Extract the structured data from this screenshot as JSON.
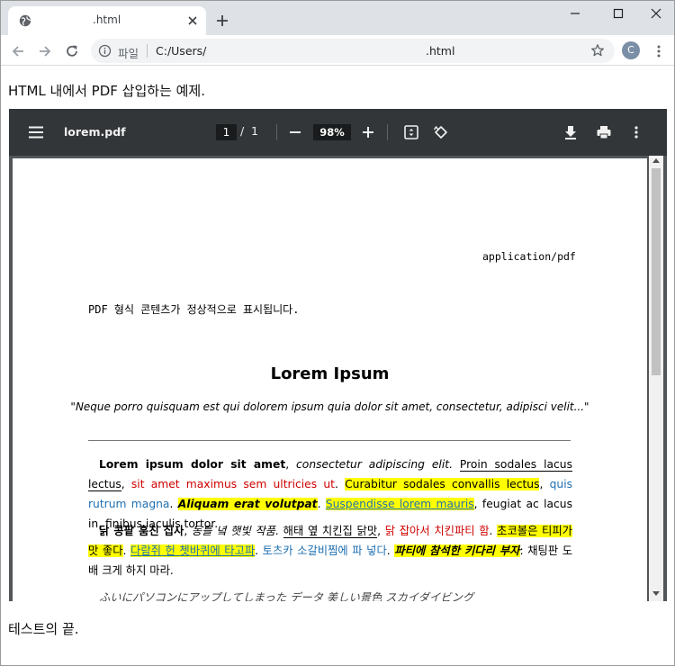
{
  "browser": {
    "tab_title": ".html",
    "url_scheme_label": "파일",
    "url_path": "C:/Users/",
    "url_file": ".html",
    "profile_initial": "C"
  },
  "page": {
    "intro": "HTML 내에서 PDF 삽입하는 예제.",
    "outro": "테스트의 끝."
  },
  "pdf_viewer": {
    "filename": "lorem.pdf",
    "current_page": "1",
    "page_separator": "/",
    "total_pages": "1",
    "zoom": "98%"
  },
  "pdf_document": {
    "mime_type": "application/pdf",
    "notice": "PDF 형식 콘텐츠가 정상적으로 표시됩니다.",
    "title": "Lorem Ipsum",
    "quote": "\"Neque porro quisquam est qui dolorem ipsum quia dolor sit amet, consectetur, adipisci velit...\"",
    "para1": {
      "s1": "Lorem ipsum dolor sit amet",
      "s2": ", ",
      "s3": "consectetur adipiscing elit.",
      "s4": " ",
      "s5": "Proin sodales lacus lectus",
      "s6": ", ",
      "s7": "sit amet maximus sem ultricies ut",
      "s8": ". ",
      "s9": "Curabitur sodales convallis lectus",
      "s10": ", ",
      "s11": "quis rutrum magna",
      "s12": ". ",
      "s13": "Aliquam erat volutpat",
      "s14": ". ",
      "s15": "Suspendisse lorem mauris",
      "s16": ", feugiat ac lacus in, finibus iaculis tortor."
    },
    "para2": {
      "s1": "닭 콩팥 훔친 집사",
      "s2": ", ",
      "s3": "동틀 녘 햇빛 작품.",
      "s4": " ",
      "s5": "해태 옆 치킨집 닭맛",
      "s6": ", ",
      "s7": "닭 잡아서 치킨파티 함",
      "s8": ". ",
      "s9": "초코볼은 티피가 맛 좋다",
      "s10": ". ",
      "s11": "다람쥐 헌 쳇바퀴에 타고파",
      "s12": ". ",
      "s13": "토츠카 소갈비찜에 파 넣다",
      "s14": ". ",
      "s15": "파티에 참석한 키다리 부자",
      "s16": ": 채팅판 도배 크게 하지 마라."
    },
    "para3": "ふいにパソコンにアップしてしまった データ 美しい景色 スカイダイビング"
  },
  "colors": {
    "highlight": "#ffff00",
    "red_text": "#d00000",
    "blue_text": "#1f6fb0",
    "pdf_toolbar": "#323639",
    "pdf_background": "#525659"
  }
}
